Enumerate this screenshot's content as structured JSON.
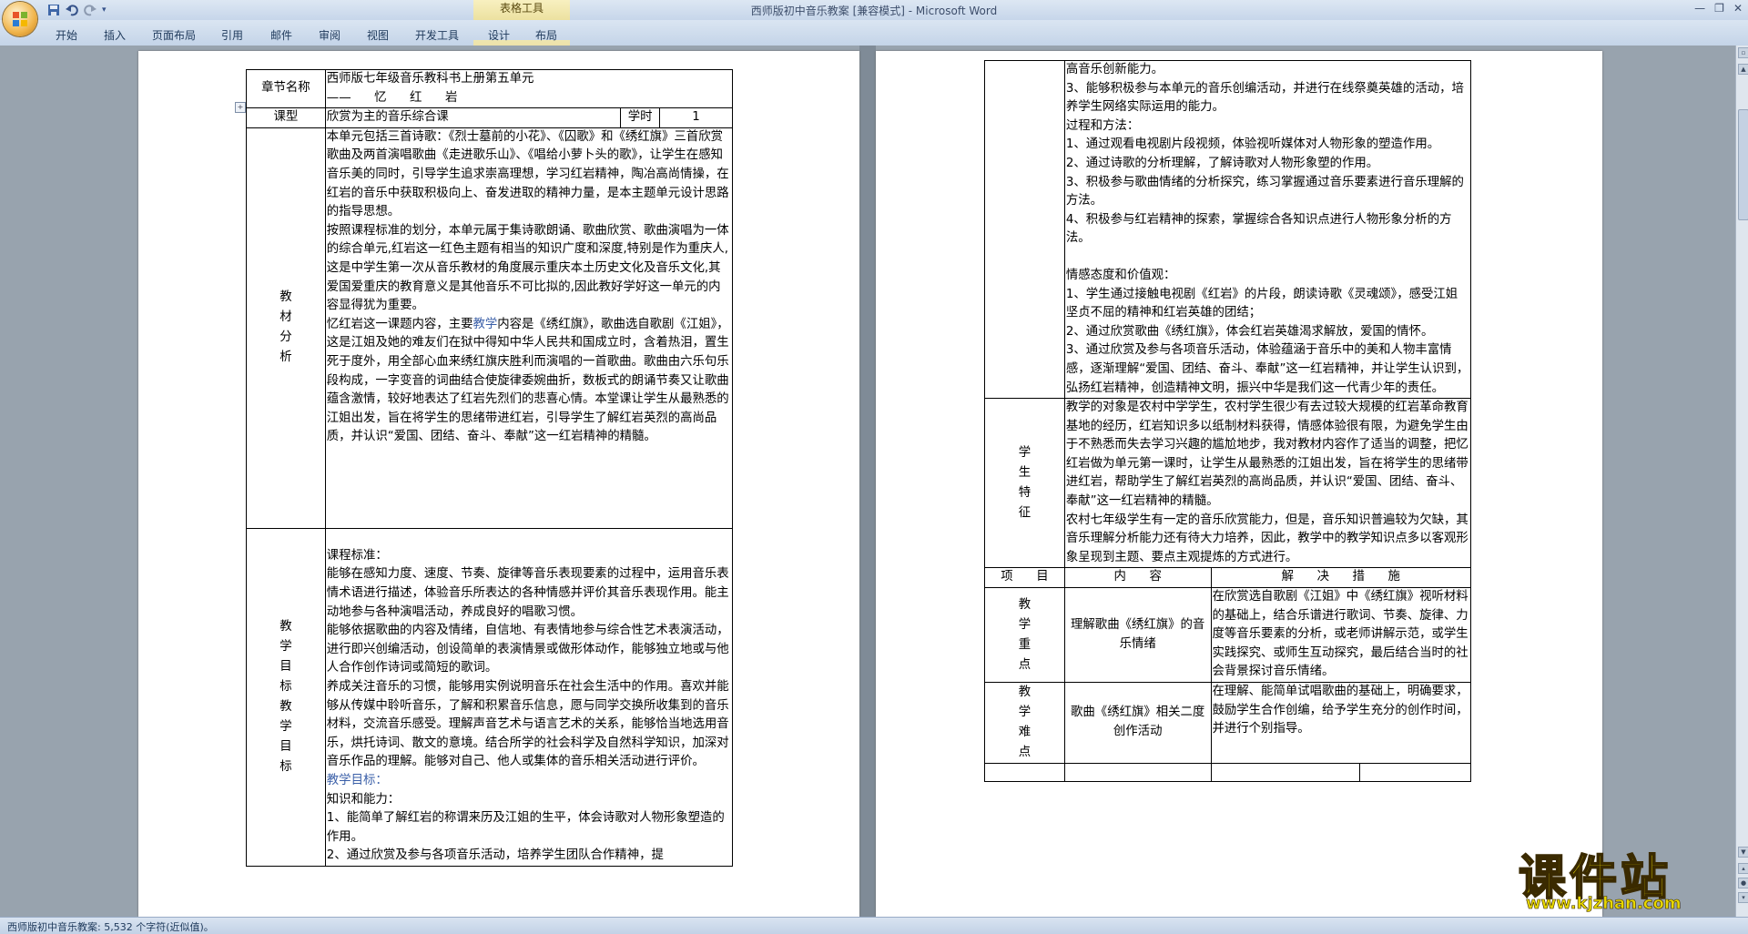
{
  "window": {
    "title": "西师版初中音乐教案 [兼容模式] - Microsoft Word",
    "contextual_group": "表格工具"
  },
  "ribbon": {
    "tabs": [
      "开始",
      "插入",
      "页面布局",
      "引用",
      "邮件",
      "审阅",
      "视图",
      "开发工具",
      "设计",
      "布局"
    ]
  },
  "page1": {
    "chapter_label": "章节名称",
    "chapter_value_line1": "西师版七年级音乐教科书上册第五单元",
    "chapter_value_line2": "——      忆      红      岩",
    "type_label": "课型",
    "type_value": "欣赏为主的音乐综合课",
    "hours_label": "学时",
    "hours_value": "1",
    "material_label": "教材分析",
    "material_p1": "本单元包括三首诗歌：《烈士墓前的小花》、《囚歌》和《绣红旗》三首欣赏歌曲及两首演唱歌曲《走进歌乐山》、《唱给小萝卜头的歌》，让学生在感知音乐美的同时，引导学生追求崇高理想，学习红岩精神，陶冶高尚情操，在红岩的音乐中获取积极向上、奋发进取的精神力量，是本主题单元设计思路的指导思想。",
    "material_p2": "按照课程标准的划分，本单元属于集诗歌朗诵、歌曲欣赏、歌曲演唱为一体的综合单元,红岩这一红色主题有相当的知识广度和深度,特别是作为重庆人,这是中学生第一次从音乐教材的角度展示重庆本土历史文化及音乐文化,其爱国爱重庆的教育意义是其他音乐不可比拟的,因此教好学好这一单元的内容显得犹为重要。",
    "material_p3_a": "忆红岩这一课题内容，主要",
    "material_p3_hl": "教学",
    "material_p3_b": "内容是《绣红旗》，歌曲选自歌剧《江姐》，这是江姐及她的难友们在狱中得知中华人民共和国成立时，含着热泪，置生死于度外，用全部心血来绣红旗庆胜利而演唱的一首歌曲。歌曲由六乐句乐段构成，一字变音的词曲结合使旋律委婉曲折，数板式的朗诵节奏又让歌曲蕴含激情，较好地表达了红岩先烈们的悲喜心情。本堂课让学生从最熟悉的江姐出发，旨在将学生的思绪带进红岩，引导学生了解红岩英烈的高尚品质，并认识“爱国、团结、奋斗、奉献”这一红岩精神的精髓。",
    "goals_label": "教学目标教学目标",
    "goals_std_title": "课程标准：",
    "goals_std_p1": "能够在感知力度、速度、节奏、旋律等音乐表现要素的过程中，运用音乐表情术语进行描述，体验音乐所表达的各种情感并评价其音乐表现作用。能主动地参与各种演唱活动，养成良好的唱歌习惯。",
    "goals_std_p2": "能够依据歌曲的内容及情绪，自信地、有表情地参与综合性艺术表演活动，进行即兴创编活动，创设简单的表演情景或做形体动作，能够独立地或与他人合作创作诗词或简短的歌词。",
    "goals_std_p3": "养成关注音乐的习惯，能够用实例说明音乐在社会生活中的作用。喜欢并能够从传媒中聆听音乐，了解和积累音乐信息，愿与同学交换所收集到的音乐材料，交流音乐感受。理解声音艺术与语言艺术的关系，能够恰当地选用音乐，烘托诗词、散文的意境。结合所学的社会科学及自然科学知识，加深对音乐作品的理解。能够对自己、他人或集体的音乐相关活动进行评价。",
    "goals_teach_title": "教学目标：",
    "goals_knowledge_title": "知识和能力：",
    "goals_k1": "1、能简单了解红岩的称谓来历及江姐的生平，体会诗歌对人物形象塑造的作用。",
    "goals_k2": "2、通过欣赏及参与各项音乐活动，培养学生团队合作精神，提"
  },
  "page2": {
    "cont_p1": "高音乐创新能力。",
    "cont_p2": "3、能够积极参与本单元的音乐创编活动，并进行在线祭奠英雄的活动，培养学生网络实际运用的能力。",
    "process_title": "过程和方法：",
    "process_1": "1、通过观看电视剧片段视频，体验视听媒体对人物形象的塑造作用。",
    "process_2": "2、通过诗歌的分析理解，了解诗歌对人物形象塑的作用。",
    "process_3": "3、积极参与歌曲情绪的分析探究，练习掌握通过音乐要素进行音乐理解的方法。",
    "process_4": "4、积极参与红岩精神的探索，掌握综合各知识点进行人物形象分析的方法。",
    "emotion_title": "情感态度和价值观：",
    "emotion_1": "1、学生通过接触电视剧《红岩》的片段，朗读诗歌《灵魂颂》，感受江姐坚贞不屈的精神和红岩英雄的团结；",
    "emotion_2": "2、通过欣赏歌曲《绣红旗》，体会红岩英雄渴求解放，爱国的情怀。",
    "emotion_3": "3、通过欣赏及参与各项音乐活动，体验蕴涵于音乐中的美和人物丰富情感，逐渐理解“爱国、团结、奋斗、奉献”这一红岩精神，并让学生认识到，弘扬红岩精神，创造精神文明，振兴中华是我们这一代青少年的责任。",
    "student_label": "学生特征",
    "student_p1": "教学的对象是农村中学学生，农村学生很少有去过较大规模的红岩革命教育基地的经历，红岩知识多以纸制材料获得，情感体验很有限，为避免学生由于不熟悉而失去学习兴趣的尴尬地步，我对教材内容作了适当的调整，把忆红岩做为单元第一课时，让学生从最熟悉的江姐出发，旨在将学生的思绪带进红岩，帮助学生了解红岩英烈的高尚品质，并认识“爱国、团结、奋斗、奉献”这一红岩精神的精髓。",
    "student_p2": "农村七年级学生有一定的音乐欣赏能力，但是，音乐知识普遍较为欠缺，其音乐理解分析能力还有待大力培养，因此，教学中的教学知识点多以客观形象呈现到主题、要点主观提炼的方式进行。",
    "hdr_item": "项      目",
    "hdr_content": "内      容",
    "hdr_solution": "解      决      措      施",
    "key_label": "教学重点",
    "key_content": "理解歌曲《绣红旗》的音乐情绪",
    "key_solution": "在欣赏选自歌剧《江姐》中《绣红旗》视听材料的基础上，结合乐谱进行歌词、节奏、旋律、力度等音乐要素的分析，或老师讲解示范，或学生实践探究、或师生互动探究，最后结合当时的社会背景探讨音乐情绪。",
    "diff_label": "教学难点",
    "diff_content": "歌曲《绣红旗》相关二度创作活动",
    "diff_solution": "在理解、能简单试唱歌曲的基础上，明确要求，鼓励学生合作创编，给予学生充分的创作时间，并进行个别指导。"
  },
  "status": {
    "text": "西师版初中音乐教案: 5,532 个字符(近似值)。"
  },
  "watermark": {
    "title": "课件站",
    "url": "www.kjzhan.com"
  },
  "colors": {
    "ribbon_bg": "#c4d4e8",
    "doc_bg": "#98a3ae",
    "contextual": "#ece1a0",
    "watermark_yellow": "#f7e600"
  }
}
